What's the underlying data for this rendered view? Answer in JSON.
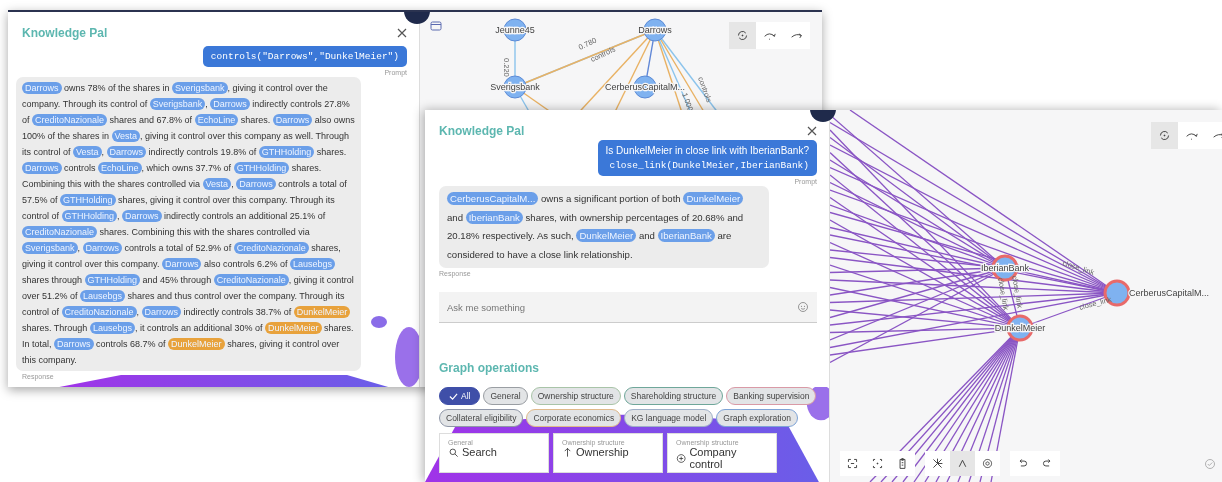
{
  "windows": [
    {
      "chat": {
        "title": "Knowledge Pal",
        "prompt": {
          "lines": [
            {
              "kind": "code",
              "text": "controls(\"Darrows\",\"DunkelMeier\")"
            }
          ],
          "label": "Prompt"
        },
        "response": {
          "label": "Response",
          "segments": [
            {
              "kind": "entity",
              "text": "Darrows",
              "color": "#6b9fe9"
            },
            {
              "kind": "text",
              "text": " owns 78% of the shares in "
            },
            {
              "kind": "entity",
              "text": "Sverigsbank",
              "color": "#6b9fe9"
            },
            {
              "kind": "text",
              "text": ", giving it control over the company. Through its control of "
            },
            {
              "kind": "entity",
              "text": "Sverigsbank",
              "color": "#6b9fe9"
            },
            {
              "kind": "text",
              "text": ", "
            },
            {
              "kind": "entity",
              "text": "Darrows",
              "color": "#6b9fe9"
            },
            {
              "kind": "text",
              "text": " indirectly controls 27.8% of "
            },
            {
              "kind": "entity",
              "text": "CreditoNazionale",
              "color": "#6b9fe9"
            },
            {
              "kind": "text",
              "text": " shares and 67.8% of "
            },
            {
              "kind": "entity",
              "text": "EchoLine",
              "color": "#6b9fe9"
            },
            {
              "kind": "text",
              "text": " shares. "
            },
            {
              "kind": "entity",
              "text": "Darrows",
              "color": "#6b9fe9"
            },
            {
              "kind": "text",
              "text": " also owns 100% of the shares in "
            },
            {
              "kind": "entity",
              "text": "Vesta",
              "color": "#6b9fe9"
            },
            {
              "kind": "text",
              "text": ", giving it control over this company as well. Through its control of "
            },
            {
              "kind": "entity",
              "text": "Vesta",
              "color": "#6b9fe9"
            },
            {
              "kind": "text",
              "text": ", "
            },
            {
              "kind": "entity",
              "text": "Darrows",
              "color": "#6b9fe9"
            },
            {
              "kind": "text",
              "text": " indirectly controls 19.8% of "
            },
            {
              "kind": "entity",
              "text": "GTHHolding",
              "color": "#6b9fe9"
            },
            {
              "kind": "text",
              "text": " shares. "
            },
            {
              "kind": "entity",
              "text": "Darrows",
              "color": "#6b9fe9"
            },
            {
              "kind": "text",
              "text": " controls "
            },
            {
              "kind": "entity",
              "text": "EchoLine",
              "color": "#6b9fe9"
            },
            {
              "kind": "text",
              "text": ", which owns 37.7% of "
            },
            {
              "kind": "entity",
              "text": "GTHHolding",
              "color": "#6b9fe9"
            },
            {
              "kind": "text",
              "text": " shares. Combining this with the shares controlled via "
            },
            {
              "kind": "entity",
              "text": "Vesta",
              "color": "#6b9fe9"
            },
            {
              "kind": "text",
              "text": ", "
            },
            {
              "kind": "entity",
              "text": "Darrows",
              "color": "#6b9fe9"
            },
            {
              "kind": "text",
              "text": " controls a total of 57.5% of "
            },
            {
              "kind": "entity",
              "text": "GTHHolding",
              "color": "#6b9fe9"
            },
            {
              "kind": "text",
              "text": " shares, giving it control over this company. Through its control of "
            },
            {
              "kind": "entity",
              "text": "GTHHolding",
              "color": "#6b9fe9"
            },
            {
              "kind": "text",
              "text": ", "
            },
            {
              "kind": "entity",
              "text": "Darrows",
              "color": "#6b9fe9"
            },
            {
              "kind": "text",
              "text": " indirectly controls an additional 25.1% of "
            },
            {
              "kind": "entity",
              "text": "CreditoNazionale",
              "color": "#6b9fe9"
            },
            {
              "kind": "text",
              "text": " shares. Combining this with the shares controlled via "
            },
            {
              "kind": "entity",
              "text": "Sverigsbank",
              "color": "#6b9fe9"
            },
            {
              "kind": "text",
              "text": ", "
            },
            {
              "kind": "entity",
              "text": "Darrows",
              "color": "#6b9fe9"
            },
            {
              "kind": "text",
              "text": " controls a total of 52.9% of "
            },
            {
              "kind": "entity",
              "text": "CreditoNazionale",
              "color": "#6b9fe9"
            },
            {
              "kind": "text",
              "text": " shares, giving it control over this company. "
            },
            {
              "kind": "entity",
              "text": "Darrows",
              "color": "#6b9fe9"
            },
            {
              "kind": "text",
              "text": " also controls 6.2% of "
            },
            {
              "kind": "entity",
              "text": "Lausebgs",
              "color": "#6b9fe9"
            },
            {
              "kind": "text",
              "text": " shares through "
            },
            {
              "kind": "entity",
              "text": "GTHHolding",
              "color": "#6b9fe9"
            },
            {
              "kind": "text",
              "text": " and 45% through "
            },
            {
              "kind": "entity",
              "text": "CreditoNazionale",
              "color": "#6b9fe9"
            },
            {
              "kind": "text",
              "text": ", giving it control over 51.2% of "
            },
            {
              "kind": "entity",
              "text": "Lausebgs",
              "color": "#6b9fe9"
            },
            {
              "kind": "text",
              "text": " shares and thus control over the company. Through its control of "
            },
            {
              "kind": "entity",
              "text": "CreditoNazionale",
              "color": "#6b9fe9"
            },
            {
              "kind": "text",
              "text": ", "
            },
            {
              "kind": "entity",
              "text": "Darrows",
              "color": "#6b9fe9"
            },
            {
              "kind": "text",
              "text": " indirectly controls 38.7% of "
            },
            {
              "kind": "entity",
              "text": "DunkelMeier",
              "color": "#e8a23c"
            },
            {
              "kind": "text",
              "text": " shares. Through "
            },
            {
              "kind": "entity",
              "text": "Lausebgs",
              "color": "#6b9fe9"
            },
            {
              "kind": "text",
              "text": ", it controls an additional 30% of "
            },
            {
              "kind": "entity",
              "text": "DunkelMeier",
              "color": "#e8a23c"
            },
            {
              "kind": "text",
              "text": " shares. In total, "
            },
            {
              "kind": "entity",
              "text": "Darrows",
              "color": "#6b9fe9"
            },
            {
              "kind": "text",
              "text": " controls 68.7% of "
            },
            {
              "kind": "entity",
              "text": "DunkelMeier",
              "color": "#e8a23c"
            },
            {
              "kind": "text",
              "text": " shares, giving it control over this company."
            }
          ]
        }
      },
      "graph": {
        "nodes": [
          {
            "label": "Jeunne45",
            "highlighted": false
          },
          {
            "label": "Darrows",
            "highlighted": false
          },
          {
            "label": "Sverigsbank",
            "highlighted": false
          },
          {
            "label": "CerberusCapitalM...",
            "highlighted": false
          }
        ],
        "edge_labels": [
          "0.780",
          "controls",
          "0.220",
          "1.000",
          "controls"
        ],
        "top_tools": [
          {
            "kind": "orbit",
            "selected": true
          },
          {
            "kind": "curve",
            "selected": false
          },
          {
            "kind": "arrow",
            "selected": false
          }
        ]
      }
    },
    {
      "chat": {
        "title": "Knowledge Pal",
        "prompt": {
          "lines": [
            {
              "kind": "text",
              "text": "Is DunkelMeier in close link with IberianBank?"
            },
            {
              "kind": "code",
              "text": "close_link(DunkelMeier,IberianBank)"
            }
          ],
          "label": "Prompt"
        },
        "response": {
          "label": "Response",
          "segments": [
            {
              "kind": "entity",
              "text": "CerberusCapitalM...",
              "color": "#6b9fe9"
            },
            {
              "kind": "text",
              "text": " owns a significant portion of both "
            },
            {
              "kind": "entity",
              "text": "DunkelMeier",
              "color": "#6b9fe9"
            },
            {
              "kind": "text",
              "text": " and "
            },
            {
              "kind": "entity",
              "text": "IberianBank",
              "color": "#6b9fe9"
            },
            {
              "kind": "text",
              "text": " shares, with ownership percentages of 20.68% and 20.18% respectively. As such, "
            },
            {
              "kind": "entity",
              "text": "DunkelMeier",
              "color": "#6b9fe9"
            },
            {
              "kind": "text",
              "text": " and "
            },
            {
              "kind": "entity",
              "text": "IberianBank",
              "color": "#6b9fe9"
            },
            {
              "kind": "text",
              "text": " are considered to have a close link relationship."
            }
          ]
        },
        "input": {
          "placeholder": "Ask me something"
        },
        "operations": {
          "title": "Graph operations",
          "filters": [
            {
              "label": "All",
              "selected": true,
              "color": "#3f4fa8"
            },
            {
              "label": "General",
              "selected": false,
              "color": "#9a9ea3"
            },
            {
              "label": "Ownership structure",
              "selected": false,
              "color": "#a9c4a8"
            },
            {
              "label": "Shareholding structure",
              "selected": false,
              "color": "#6fa79a"
            },
            {
              "label": "Banking supervision",
              "selected": false,
              "color": "#d99aa6"
            },
            {
              "label": "Collateral eligibility",
              "selected": false,
              "color": "#8f97a8"
            },
            {
              "label": "Corporate economics",
              "selected": false,
              "color": "#e0b98a"
            },
            {
              "label": "KG language model",
              "selected": false,
              "color": "#9fb0c8"
            },
            {
              "label": "Graph exploration",
              "selected": false,
              "color": "#7ea3d6"
            }
          ],
          "cards": [
            {
              "category": "General",
              "title": "Search",
              "kind": "search"
            },
            {
              "category": "Ownership structure",
              "title": "Ownership",
              "kind": "up"
            },
            {
              "category": "Ownership structure",
              "title": "Company control",
              "kind": "plus"
            }
          ]
        }
      },
      "graph": {
        "nodes": [
          {
            "label": "IberianBank",
            "highlighted": true
          },
          {
            "label": "CerberusCapitalM...",
            "highlighted": true
          },
          {
            "label": "DunkelMeier",
            "highlighted": true
          }
        ],
        "edge_labels": [
          "close_link",
          "close_link",
          "close_link",
          "close_link"
        ],
        "top_tools": [
          {
            "kind": "orbit",
            "selected": true
          },
          {
            "kind": "curve",
            "selected": false
          },
          {
            "kind": "arrow",
            "selected": false
          }
        ],
        "bottom_tools": [
          [
            {
              "kind": "fit",
              "selected": false
            },
            {
              "kind": "focus",
              "selected": false
            },
            {
              "kind": "clipboard",
              "selected": false
            }
          ],
          [
            {
              "kind": "network",
              "selected": false
            },
            {
              "kind": "tree",
              "selected": true
            },
            {
              "kind": "target",
              "selected": false
            }
          ],
          [
            {
              "kind": "undo",
              "selected": false
            },
            {
              "kind": "redo",
              "selected": false
            }
          ]
        ]
      }
    }
  ]
}
